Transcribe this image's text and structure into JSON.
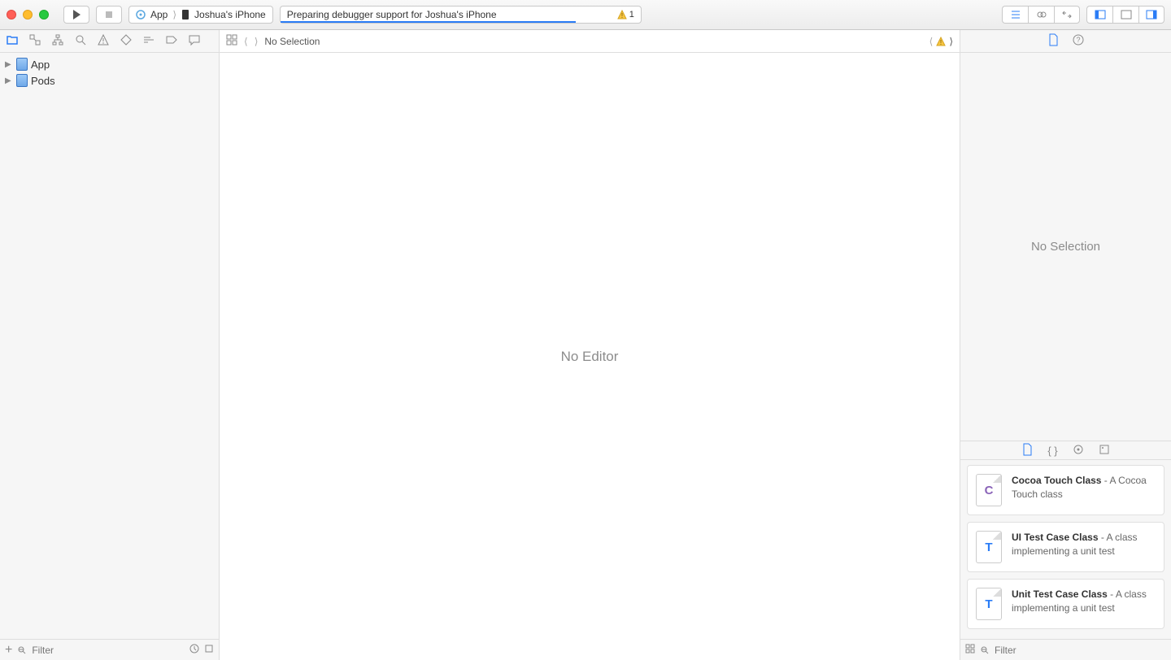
{
  "toolbar": {
    "scheme_app": "App",
    "scheme_device": "Joshua's iPhone",
    "activity_text": "Preparing debugger support for Joshua's iPhone",
    "warning_count": "1"
  },
  "navigator": {
    "items": [
      {
        "label": "App"
      },
      {
        "label": "Pods"
      }
    ],
    "filter_placeholder": "Filter"
  },
  "editor": {
    "jumpbar_text": "No Selection",
    "empty_text": "No Editor"
  },
  "inspector": {
    "empty_text": "No Selection",
    "library": [
      {
        "icon": "C",
        "title": "Cocoa Touch Class",
        "desc": " - A Cocoa Touch class"
      },
      {
        "icon": "T",
        "title": "UI Test Case Class",
        "desc": " - A class implementing a unit test"
      },
      {
        "icon": "T",
        "title": "Unit Test Case Class",
        "desc": " - A class implementing a unit test"
      }
    ],
    "filter_placeholder": "Filter"
  }
}
